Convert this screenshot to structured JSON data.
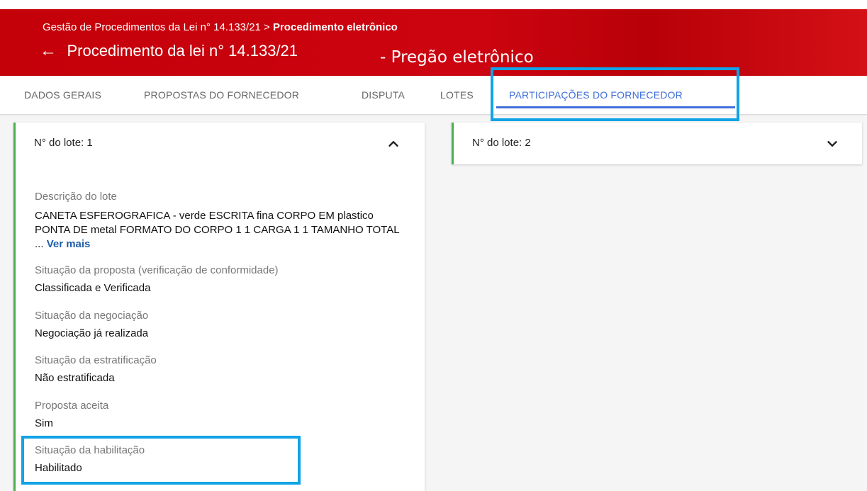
{
  "header": {
    "breadcrumb_path": "Gestão de Procedimentos da Lei n° 14.133/21 > ",
    "breadcrumb_current": "Procedimento eletrônico",
    "back_icon": "←",
    "title": "Procedimento da lei n° 14.133/21",
    "subtitle": "- Pregão eletrônico",
    "color": "#c40009"
  },
  "tabs": [
    {
      "label": "DADOS GERAIS"
    },
    {
      "label": "PROPOSTAS DO FORNECEDOR"
    },
    {
      "label": "DISPUTA"
    },
    {
      "label": "LOTES"
    },
    {
      "label": "PARTICIPAÇÕES DO FORNECEDOR",
      "active": true
    }
  ],
  "accent_color": "#3f6fd8",
  "highlight_color": "#12a3e6",
  "lotes": [
    {
      "header": "N° do lote: 1",
      "expanded": true,
      "chevron_icon": "chevron-up-icon",
      "descricao_label": "Descrição do lote",
      "descricao_text": "CANETA ESFEROGRAFICA - verde ESCRITA fina CORPO EM plastico PONTA DE metal FORMATO DO CORPO 1 1 CARGA 1 1 TAMANHO TOTAL ...",
      "ver_mais": "Ver mais",
      "fields": [
        {
          "label": "Situação da proposta (verificação de conformidade)",
          "value": "Classificada e Verificada"
        },
        {
          "label": "Situação da negociação",
          "value": "Negociação já realizada"
        },
        {
          "label": "Situação da estratificação",
          "value": "Não estratificada"
        },
        {
          "label": "Proposta aceita",
          "value": "Sim"
        },
        {
          "label": "Situação da habilitação",
          "value": "Habilitado"
        }
      ]
    },
    {
      "header": "N° do lote: 2",
      "expanded": false,
      "chevron_icon": "chevron-down-icon"
    }
  ]
}
